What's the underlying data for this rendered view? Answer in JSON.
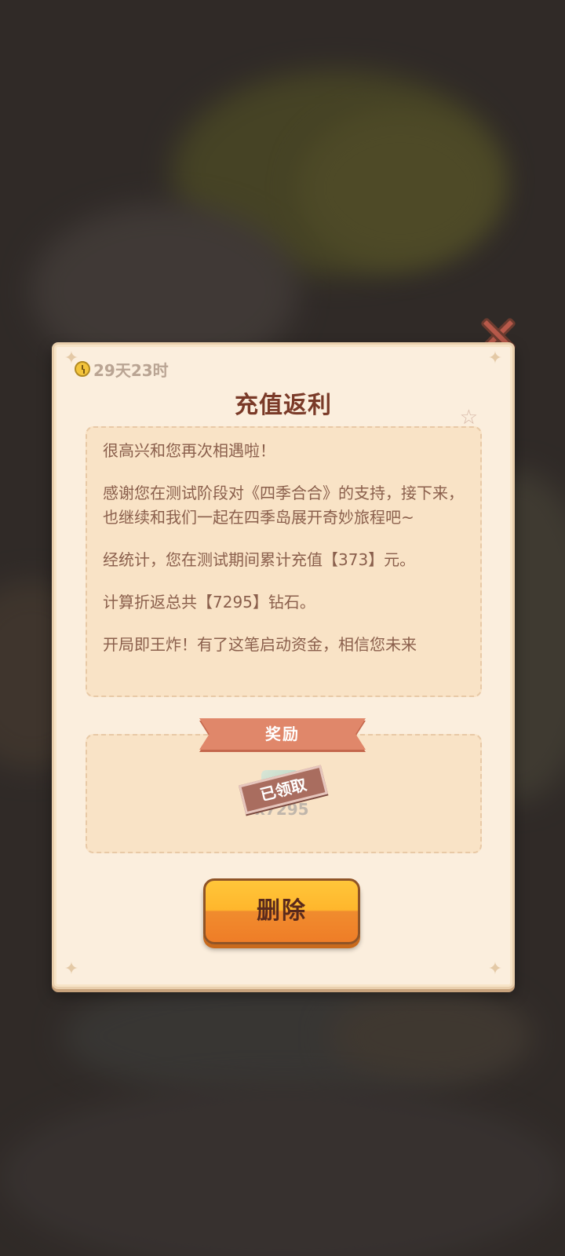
{
  "popup": {
    "timer_text": "29天23时",
    "title": "充值返利",
    "message": {
      "line1": "很高兴和您再次相遇啦！",
      "line2": "感谢您在测试阶段对《四季合合》的支持，接下来，也继续和我们一起在四季岛展开奇妙旅程吧~",
      "line3": "经统计，您在测试期间累计充值【373】元。",
      "line4": "计算折返总共【7295】钻石。",
      "line5": "开局即王炸！有了这笔启动资金，相信您未来"
    },
    "reward_label": "奖励",
    "reward_item": {
      "icon": "diamond-icon",
      "count": "x7295",
      "status": "已领取"
    },
    "delete_label": "删除"
  },
  "colors": {
    "panel_bg": "#fbeedd",
    "title": "#7a3a28",
    "body_text": "#8a5f4c",
    "ribbon": "#e0876a",
    "button": "#ffb62c",
    "close": "#b7594a"
  }
}
